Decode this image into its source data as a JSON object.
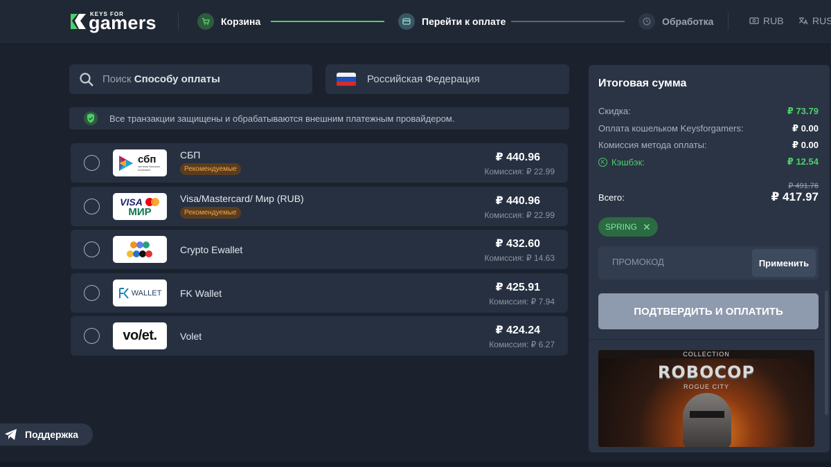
{
  "brand": {
    "small": "KEYS FOR",
    "big": "gamers"
  },
  "steps": [
    {
      "label": "Корзина",
      "state": "done"
    },
    {
      "label": "Перейти к оплате",
      "state": "active"
    },
    {
      "label": "Обработка",
      "state": "pending"
    }
  ],
  "header_right": {
    "currency": "RUB",
    "language": "RUS"
  },
  "search": {
    "placeholder_prefix": "Поиск ",
    "placeholder_bold": "Способу оплаты"
  },
  "country": "Российская Федерация",
  "secure_notice": "Все транзакции защищены и обрабатываются внешним платежным провайдером.",
  "methods": [
    {
      "name": "СБП",
      "badge": "Рекомендуемые",
      "price": "₽ 440.96",
      "fee": "Комиссия: ₽ 22.99",
      "logo": "sbp"
    },
    {
      "name": "Visa/Mastercard/ Мир (RUB)",
      "badge": "Рекомендуемые",
      "price": "₽ 440.96",
      "fee": "Комиссия: ₽ 22.99",
      "logo": "visa-mir"
    },
    {
      "name": "Crypto Ewallet",
      "badge": "",
      "price": "₽ 432.60",
      "fee": "Комиссия: ₽ 14.63",
      "logo": "crypto"
    },
    {
      "name": "FK Wallet",
      "badge": "",
      "price": "₽ 425.91",
      "fee": "Комиссия: ₽ 7.94",
      "logo": "fk-wallet"
    },
    {
      "name": "Volet",
      "badge": "",
      "price": "₽ 424.24",
      "fee": "Комиссия: ₽ 6.27",
      "logo": "volet"
    }
  ],
  "logos": {
    "sbp_text": "сбп",
    "sbp_sub": "система быстрых платежей",
    "visa": "VISA",
    "mir": "МИР",
    "fk": "WALLET",
    "volet": "vo/et."
  },
  "summary": {
    "title": "Итоговая сумма",
    "rows": [
      {
        "label": "Скидка:",
        "value": "₽ 73.79"
      },
      {
        "label": "Оплата кошельком Keysforgamers:",
        "value": "₽ 0.00"
      },
      {
        "label": "Комиссия метода оплаты:",
        "value": "₽ 0.00"
      },
      {
        "label": "Кэшбэк:",
        "value": "₽ 12.54"
      }
    ],
    "old_total": "₽ 491.76",
    "total_label": "Всего:",
    "total_value": "₽ 417.97",
    "coupon": "SPRING",
    "promo_placeholder": "ПРОМОКОД",
    "apply_label": "Применить",
    "confirm_label": "ПОДТВЕРДИТЬ И ОПЛАТИТЬ"
  },
  "game": {
    "collection": "COLLECTION",
    "logo": "ROBOCOP",
    "subtitle": "ROGUE CITY"
  },
  "support_label": "Поддержка",
  "colors": {
    "accent": "#4cd06a",
    "background": "#1b222e",
    "panel": "#2a3444",
    "badge": "#f2a84a"
  }
}
